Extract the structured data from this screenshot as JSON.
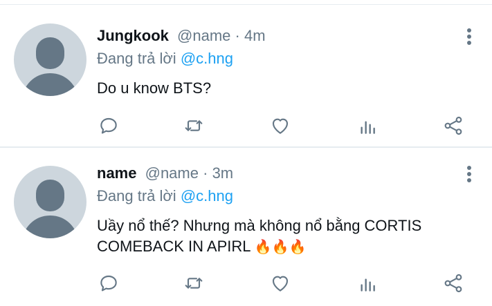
{
  "tweets": [
    {
      "name": "Jungkook",
      "handle": "@name",
      "separator": "·",
      "time": "4m",
      "reply_prefix": "Đang trả lời",
      "reply_to": "@c.hng",
      "text_lines": [
        "Do u know BTS?"
      ]
    },
    {
      "name": "name",
      "handle": "@name",
      "separator": "·",
      "time": "3m",
      "reply_prefix": "Đang trả lời",
      "reply_to": "@c.hng",
      "text_lines": [
        "Uầy nổ thế? Nhưng mà không nổ bằng CORTIS",
        "COMEBACK IN APIRL"
      ],
      "emoji": "🔥🔥🔥"
    }
  ],
  "icons": {
    "reply": "comment-icon",
    "retweet": "retweet-icon",
    "like": "heart-icon",
    "stats": "analytics-icon",
    "share": "share-icon",
    "more": "more-vertical-icon"
  },
  "colors": {
    "text": "#0f1419",
    "secondary": "#657786",
    "link": "#1da1f2",
    "avatar_bg": "#cdd6dd",
    "divider": "#e6ecf0"
  }
}
